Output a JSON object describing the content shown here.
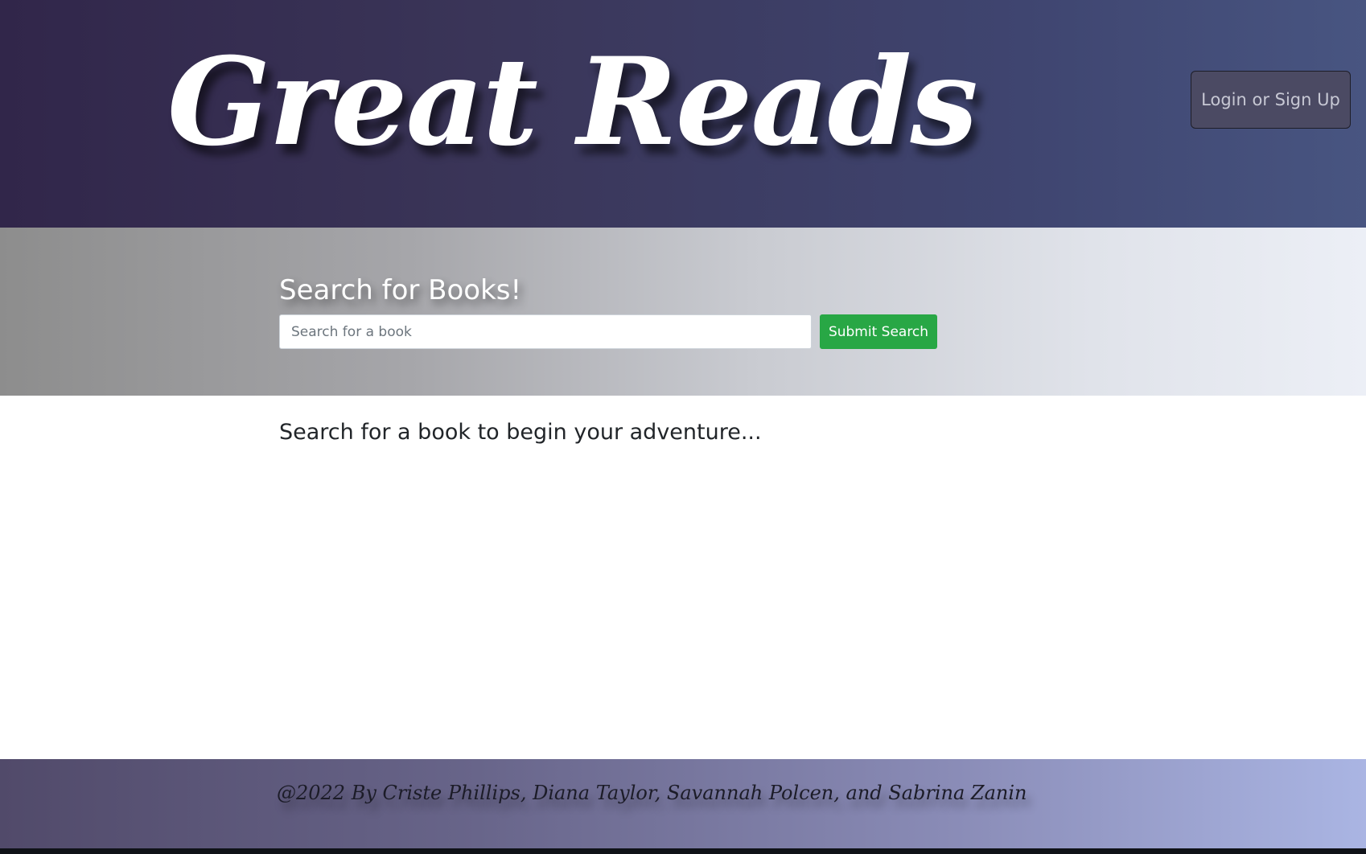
{
  "header": {
    "brand": "Great Reads",
    "login_label": "Login or Sign Up"
  },
  "search": {
    "title": "Search for Books!",
    "placeholder": "Search for a book",
    "value": "",
    "submit_label": "Submit Search"
  },
  "main": {
    "message": "Search for a book to begin your adventure..."
  },
  "footer": {
    "credits": "@2022 By Criste Phillips, Diana Taylor, Savannah Polcen, and Sabrina Zanin"
  },
  "colors": {
    "submit_green": "#28a745",
    "header_dark": "#31264a",
    "header_blue": "#485581",
    "footer_light": "#aab5e3"
  }
}
